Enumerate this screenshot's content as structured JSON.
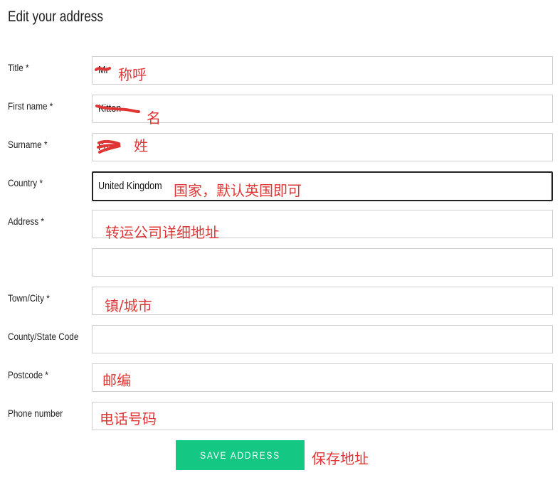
{
  "page_title": "Edit your address",
  "form": {
    "title": {
      "label": "Title *",
      "value": "Mr",
      "annotation": "称呼"
    },
    "first_name": {
      "label": "First name *",
      "value": "Kitten",
      "annotation": "名"
    },
    "surname": {
      "label": "Surname *",
      "value": "Fu",
      "annotation": "姓"
    },
    "country": {
      "label": "Country *",
      "value": "United Kingdom",
      "annotation": "国家，默认英国即可"
    },
    "address": {
      "label": "Address *",
      "value_line1": "",
      "value_line2": "",
      "annotation": "转运公司详细地址"
    },
    "town_city": {
      "label": "Town/City *",
      "value": "",
      "annotation": "镇/城市"
    },
    "county_state": {
      "label": "County/State Code",
      "value": ""
    },
    "postcode": {
      "label": "Postcode *",
      "value": "",
      "annotation": "邮编"
    },
    "phone": {
      "label": "Phone number",
      "value": "",
      "annotation": "电话号码"
    }
  },
  "save_button": {
    "label": "SAVE ADDRESS",
    "annotation": "保存地址"
  },
  "colors": {
    "annotation": "#e03535",
    "button": "#14c783",
    "active_border": "#222222",
    "field_border": "#cfcfcf"
  }
}
